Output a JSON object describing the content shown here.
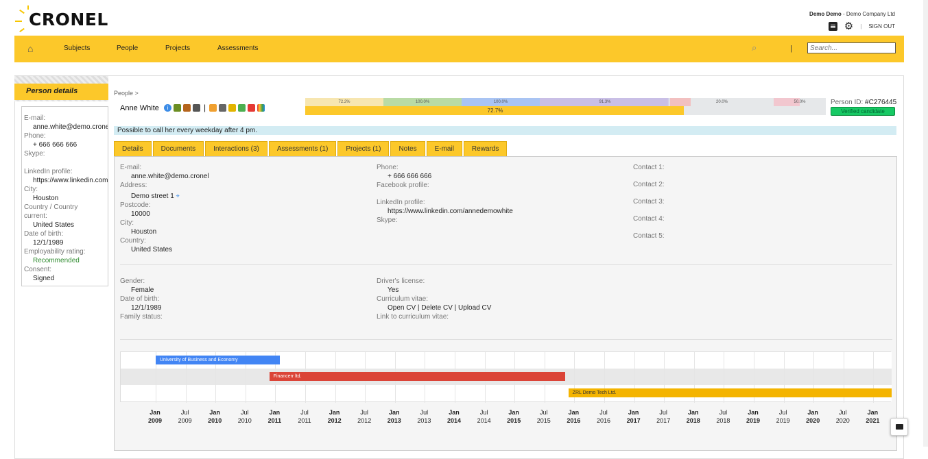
{
  "brand": {
    "name": "CRONEL"
  },
  "user": {
    "name": "Demo Demo",
    "company": " - Demo Company Ltd",
    "sign_out": "SIGN OUT",
    "separator": "|"
  },
  "nav": {
    "items": [
      "Subjects",
      "People",
      "Projects",
      "Assessments"
    ],
    "search_placeholder": "Search...",
    "separator": "|"
  },
  "sidebar": {
    "title": "Person details",
    "fields": [
      {
        "label": "E-mail:",
        "value": "anne.white@demo.cronel"
      },
      {
        "label": "Phone:",
        "value": "+ 666 666 666"
      },
      {
        "label": "Skype:",
        "value": ""
      },
      {
        "label": "LinkedIn profile:",
        "value": "https://www.linkedin.com/annedemowhite"
      },
      {
        "label": "City:",
        "value": "Houston"
      },
      {
        "label": "Country / Country current:",
        "value": "United States"
      },
      {
        "label": "Date of birth:",
        "value": "12/1/1989"
      },
      {
        "label": "Employability rating:",
        "value": "Recommended"
      },
      {
        "label": "Consent:",
        "value": "Signed"
      }
    ]
  },
  "person": {
    "breadcrumb": "People >",
    "name": "Anne White",
    "id_label": "Person ID: ",
    "id": "#C276445",
    "badge": "Verified candidate",
    "note": "Possible to call her every weekday after 4 pm."
  },
  "progress": {
    "segments": [
      {
        "label": "72.2%",
        "color": "#f7e6b0"
      },
      {
        "label": "100.0%",
        "color": "#b9dba5"
      },
      {
        "label": "100.0%",
        "color": "#a9c4f3"
      },
      {
        "label": "91.3%",
        "color": "#c9bfe6"
      },
      {
        "label": "20.0%",
        "color": "#f2c0c0"
      },
      {
        "label": "50.0%",
        "color": "#f2c7cf"
      }
    ],
    "overall": {
      "label": "72.7%",
      "fraction": 0.727
    }
  },
  "tabs": [
    "Details",
    "Documents",
    "Interactions (3)",
    "Assessments (1)",
    "Projects (1)",
    "Notes",
    "E-mail",
    "Rewards"
  ],
  "details": {
    "email_label": "E-mail:",
    "email": "anne.white@demo.cronel",
    "address_label": "Address:",
    "address": "Demo street 1",
    "postcode_label": "Postcode:",
    "postcode": "10000",
    "city_label": "City:",
    "city": "Houston",
    "country_label": "Country:",
    "country": "United States",
    "phone_label": "Phone:",
    "phone": "+ 666 666 666",
    "facebook_label": "Facebook profile:",
    "linkedin_label": "LinkedIn profile:",
    "linkedin": "https://www.linkedin.com/annedemowhite",
    "skype_label": "Skype:",
    "contacts": [
      "Contact 1:",
      "Contact 2:",
      "Contact 3:",
      "Contact 4:",
      "Contact 5:"
    ],
    "gender_label": "Gender:",
    "gender": "Female",
    "dob_label": "Date of birth:",
    "dob": "12/1/1989",
    "family_label": "Family status:",
    "license_label": "Driver's license:",
    "license": "Yes",
    "cv_label": "Curriculum vitae:",
    "cv_open": "Open CV",
    "cv_delete": "Delete CV",
    "cv_upload": "Upload CV",
    "cv_sep": " | ",
    "cv_link_label": "Link to curriculum vitae:"
  },
  "timeline": {
    "bars": [
      {
        "label": "University of Business and Economy",
        "start": 2009.0,
        "end": 2011.08,
        "row": 0,
        "color": "#4285f4"
      },
      {
        "label": "Financerr ltd.",
        "start": 2010.9,
        "end": 2015.85,
        "row": 1,
        "color": "#db4437"
      },
      {
        "label": "ZRL Demo Tech Ltd.",
        "start": 2015.9,
        "end": 2021.3,
        "row": 2,
        "color": "#f4b400"
      }
    ],
    "ticks": [
      {
        "m": "Jan",
        "y": "2009",
        "bold": true
      },
      {
        "m": "Jul",
        "y": "2009",
        "bold": false
      },
      {
        "m": "Jan",
        "y": "2010",
        "bold": true
      },
      {
        "m": "Jul",
        "y": "2010",
        "bold": false
      },
      {
        "m": "Jan",
        "y": "2011",
        "bold": true
      },
      {
        "m": "Jul",
        "y": "2011",
        "bold": false
      },
      {
        "m": "Jan",
        "y": "2012",
        "bold": true
      },
      {
        "m": "Jul",
        "y": "2012",
        "bold": false
      },
      {
        "m": "Jan",
        "y": "2013",
        "bold": true
      },
      {
        "m": "Jul",
        "y": "2013",
        "bold": false
      },
      {
        "m": "Jan",
        "y": "2014",
        "bold": true
      },
      {
        "m": "Jul",
        "y": "2014",
        "bold": false
      },
      {
        "m": "Jan",
        "y": "2015",
        "bold": true
      },
      {
        "m": "Jul",
        "y": "2015",
        "bold": false
      },
      {
        "m": "Jan",
        "y": "2016",
        "bold": true
      },
      {
        "m": "Jul",
        "y": "2016",
        "bold": false
      },
      {
        "m": "Jan",
        "y": "2017",
        "bold": true
      },
      {
        "m": "Jul",
        "y": "2017",
        "bold": false
      },
      {
        "m": "Jan",
        "y": "2018",
        "bold": true
      },
      {
        "m": "Jul",
        "y": "2018",
        "bold": false
      },
      {
        "m": "Jan",
        "y": "2019",
        "bold": true
      },
      {
        "m": "Jul",
        "y": "2019",
        "bold": false
      },
      {
        "m": "Jan",
        "y": "2020",
        "bold": true
      },
      {
        "m": "Jul",
        "y": "2020",
        "bold": false
      },
      {
        "m": "Jan",
        "y": "2021",
        "bold": true
      }
    ]
  }
}
